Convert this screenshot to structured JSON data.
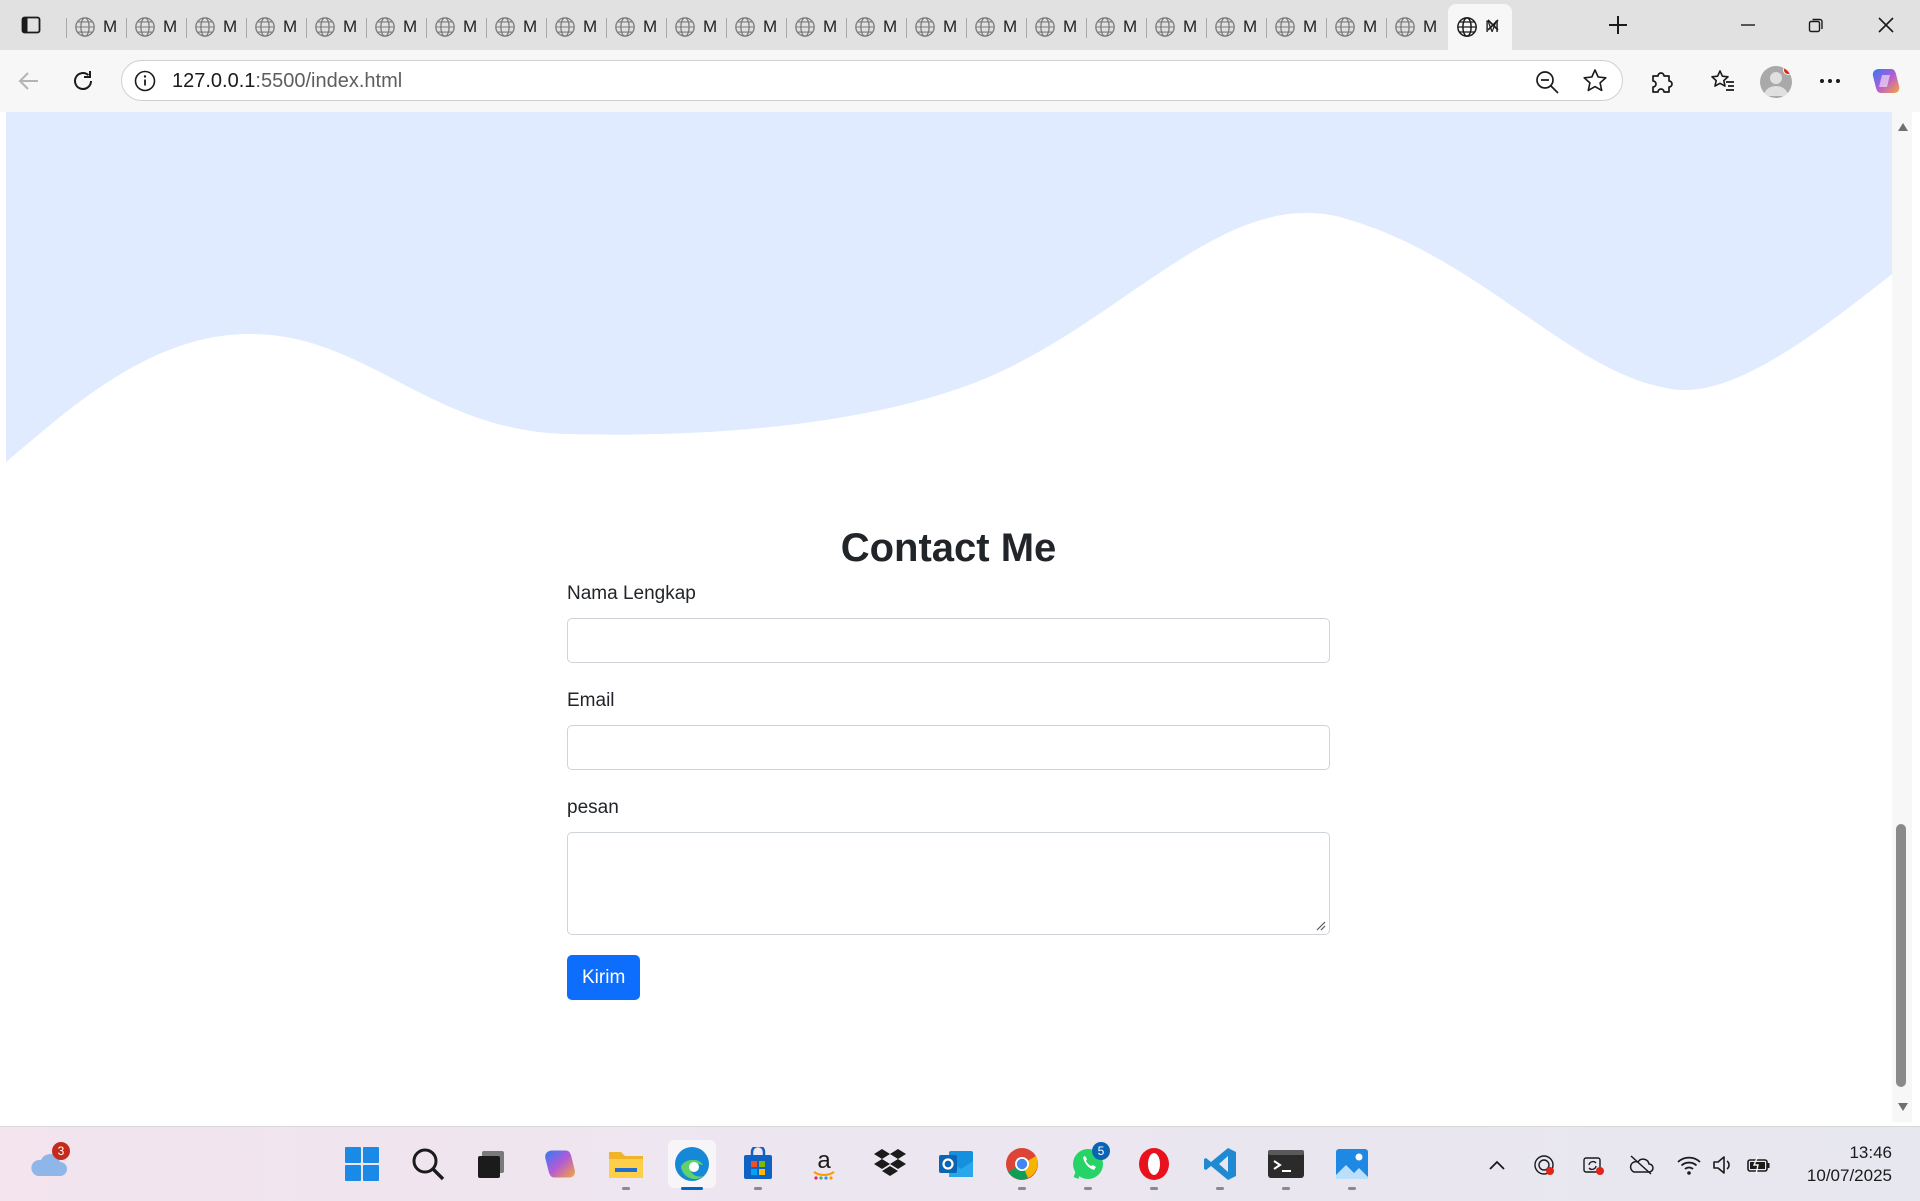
{
  "browser": {
    "tabs": [
      {
        "label": "M"
      },
      {
        "label": "M"
      },
      {
        "label": "M"
      },
      {
        "label": "M"
      },
      {
        "label": "M"
      },
      {
        "label": "M"
      },
      {
        "label": "M"
      },
      {
        "label": "M"
      },
      {
        "label": "M"
      },
      {
        "label": "M"
      },
      {
        "label": "M"
      },
      {
        "label": "M"
      },
      {
        "label": "M"
      },
      {
        "label": "M"
      },
      {
        "label": "M"
      },
      {
        "label": "M"
      },
      {
        "label": "M"
      },
      {
        "label": "M"
      },
      {
        "label": "M"
      },
      {
        "label": "M"
      },
      {
        "label": "M"
      },
      {
        "label": "M"
      },
      {
        "label": "M"
      }
    ],
    "active_tab_label": "M",
    "url_host": "127.0.0.1",
    "url_rest": ":5500/index.html"
  },
  "page": {
    "wave_color": "#e0ebff",
    "contact": {
      "title": "Contact Me",
      "name_label": "Nama Lengkap",
      "email_label": "Email",
      "message_label": "pesan",
      "submit_label": "Kirim",
      "accent": "#0d6efd"
    }
  },
  "taskbar": {
    "weather_badge": "3",
    "whatsapp_badge": "5",
    "time": "13:46",
    "date": "10/07/2025"
  }
}
